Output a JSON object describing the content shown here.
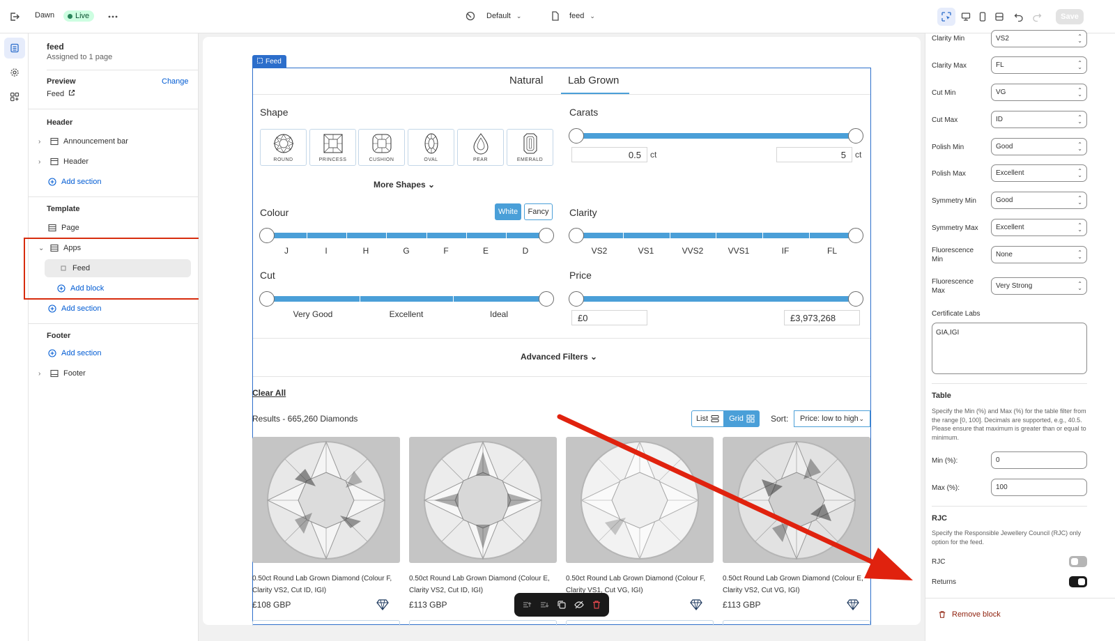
{
  "topbar": {
    "theme_name": "Dawn",
    "live_label": "Live",
    "theme_select": "Default",
    "page_select": "feed",
    "save_label": "Save"
  },
  "sidebar": {
    "page_title": "feed",
    "assigned": "Assigned to 1 page",
    "preview_label": "Preview",
    "change_label": "Change",
    "preview_value": "Feed",
    "header_group": "Header",
    "announcement_bar": "Announcement bar",
    "header_item": "Header",
    "add_section_1": "Add section",
    "template_group": "Template",
    "page_item": "Page",
    "apps_item": "Apps",
    "feed_block": "Feed",
    "add_block": "Add block",
    "add_section_2": "Add section",
    "footer_group": "Footer",
    "add_section_3": "Add section",
    "footer_item": "Footer"
  },
  "preview": {
    "feed_tag": "Feed",
    "tabs": [
      "Natural",
      "Lab Grown"
    ],
    "active_tab": "Lab Grown",
    "shape_label": "Shape",
    "shapes": [
      "ROUND",
      "PRINCESS",
      "CUSHION",
      "OVAL",
      "PEAR",
      "EMERALD"
    ],
    "more_shapes": "More Shapes",
    "carats_label": "Carats",
    "carat_min": "0.5",
    "carat_max": "5",
    "carat_unit": "ct",
    "colour_label": "Colour",
    "colour_white": "White",
    "colour_fancy": "Fancy",
    "colour_ticks": [
      "J",
      "I",
      "H",
      "G",
      "F",
      "E",
      "D"
    ],
    "clarity_label": "Clarity",
    "clarity_ticks": [
      "VS2",
      "VS1",
      "VVS2",
      "VVS1",
      "IF",
      "FL"
    ],
    "cut_label": "Cut",
    "cut_ticks": [
      "Very Good",
      "Excellent",
      "Ideal"
    ],
    "price_label": "Price",
    "price_min": "£0",
    "price_max": "£3,973,268",
    "advanced_filters": "Advanced Filters",
    "clear_all": "Clear All",
    "results": "Results - 665,260 Diamonds",
    "view_list": "List",
    "view_grid": "Grid",
    "sort_label": "Sort:",
    "sort_value": "Price: low to high",
    "products": [
      {
        "line1": "0.50ct Round Lab Grown Diamond (Colour F,",
        "line2": "Clarity VS2, Cut ID, IGI)",
        "price": "£108 GBP"
      },
      {
        "line1": "0.50ct Round Lab Grown Diamond (Colour E,",
        "line2": "Clarity VS2, Cut ID, IGI)",
        "price": "£113 GBP"
      },
      {
        "line1": "0.50ct Round Lab Grown Diamond (Colour F,",
        "line2": "Clarity VS1, Cut VG, IGI)",
        "price": ""
      },
      {
        "line1": "0.50ct Round Lab Grown Diamond (Colour E,",
        "line2": "Clarity VS2, Cut VG, IGI)",
        "price": "£113 GBP"
      }
    ]
  },
  "settings": {
    "fields": [
      {
        "label": "Clarity Min",
        "value": "VS2"
      },
      {
        "label": "Clarity Max",
        "value": "FL"
      },
      {
        "label": "Cut Min",
        "value": "VG"
      },
      {
        "label": "Cut Max",
        "value": "ID"
      },
      {
        "label": "Polish Min",
        "value": "Good"
      },
      {
        "label": "Polish Max",
        "value": "Excellent"
      },
      {
        "label": "Symmetry Min",
        "value": "Good"
      },
      {
        "label": "Symmetry Max",
        "value": "Excellent"
      },
      {
        "label": "Fluorescence Min",
        "value": "None"
      },
      {
        "label": "Fluorescence Max",
        "value": "Very Strong"
      }
    ],
    "cert_label": "Certificate Labs",
    "cert_value": "GIA,IGI",
    "table_heading": "Table",
    "table_help": "Specify the Min (%) and Max (%) for the table filter from the range [0, 100]. Decimals are supported, e.g., 40.5. Please ensure that maximum is greater than or equal to minimum.",
    "min_label": "Min (%):",
    "min_value": "0",
    "max_label": "Max (%):",
    "max_value": "100",
    "rjc_heading": "RJC",
    "rjc_help": "Specify the Responsible Jewellery Council (RJC) only option for the feed.",
    "rjc_label": "RJC",
    "rjc_on": false,
    "returns_label": "Returns",
    "returns_on": true,
    "remove_block": "Remove block"
  },
  "colors": {
    "accent": "#2c6ecb",
    "slider": "#4a9fd8",
    "annotation": "#d72c0d",
    "live": "#29845a"
  }
}
